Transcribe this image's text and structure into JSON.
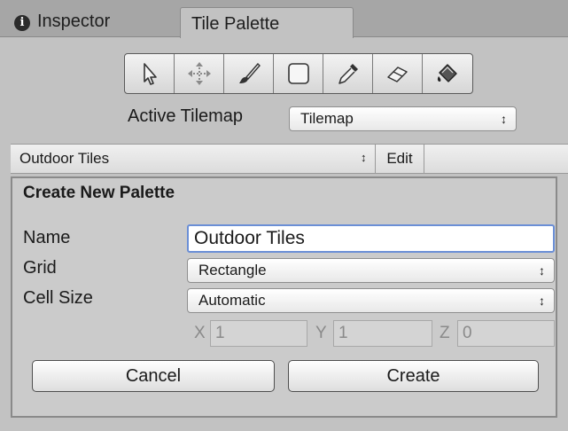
{
  "tabs": [
    {
      "label": "Inspector",
      "icon": "info-icon"
    },
    {
      "label": "Tile Palette",
      "active": true
    }
  ],
  "tools": [
    "select-tool-icon",
    "move-tool-icon",
    "paint-brush-icon",
    "box-fill-icon",
    "picker-icon",
    "eraser-icon",
    "fill-bucket-icon"
  ],
  "active_tilemap": {
    "label": "Active Tilemap",
    "value": "Tilemap"
  },
  "palette_bar": {
    "selected": "Outdoor Tiles",
    "edit_label": "Edit"
  },
  "dialog": {
    "title": "Create New Palette",
    "name_label": "Name",
    "name_value": "Outdoor Tiles",
    "grid_label": "Grid",
    "grid_value": "Rectangle",
    "cellsize_label": "Cell Size",
    "cellsize_value": "Automatic",
    "x_label": "X",
    "x_value": "1",
    "y_label": "Y",
    "y_value": "1",
    "z_label": "Z",
    "z_value": "0",
    "cancel_label": "Cancel",
    "create_label": "Create"
  },
  "colors": {
    "focus_border": "#6b8fd6",
    "panel_bg": "#c2c2c2"
  }
}
